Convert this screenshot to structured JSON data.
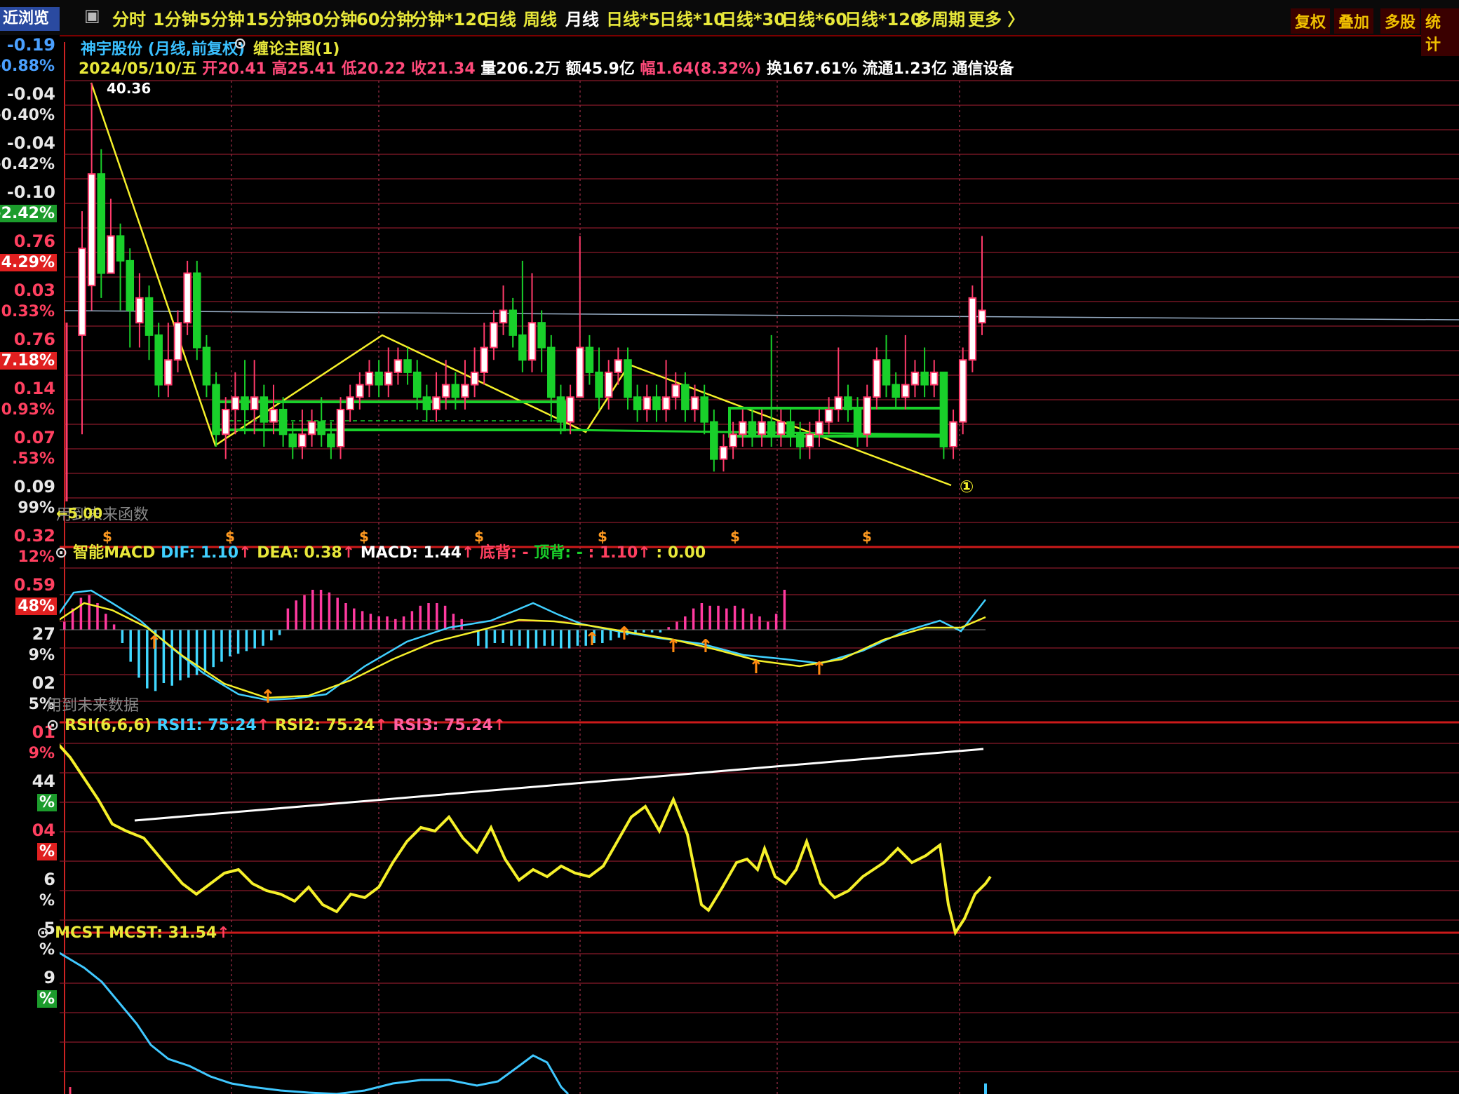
{
  "top_tabs": [
    "分时",
    "1分钟",
    "5分钟",
    "15分钟",
    "30分钟",
    "60分钟",
    "分钟*120",
    "日线",
    "周线",
    "月线",
    "日线*5",
    "日线*10",
    "日线*30",
    "日线*60",
    "日线*120",
    "多周期",
    "更多 〉"
  ],
  "active_tab": "月线",
  "right_buttons": [
    "复权",
    "叠加",
    "多股",
    "统计"
  ],
  "left_panel": {
    "title": "近浏览",
    "items": [
      {
        "v": "-0.19",
        "p": "-0.88%",
        "c": "#4aa0ff",
        "bg": ""
      },
      {
        "v": "-0.04",
        "p": "-0.40%",
        "c": "#e8e8e8",
        "bg": ""
      },
      {
        "v": "-0.04",
        "p": "-0.42%",
        "c": "#e8e8e8",
        "bg": ""
      },
      {
        "v": "-0.10",
        "p": "-2.42%",
        "c": "#e8e8e8",
        "bg": "#1c9c2c"
      },
      {
        "v": "0.76",
        "p": "4.29%",
        "c": "#ff4060",
        "bg": "#e02020"
      },
      {
        "v": "0.03",
        "p": "0.33%",
        "c": "#ff4060",
        "bg": ""
      },
      {
        "v": "0.76",
        "p": "7.18%",
        "c": "#ff4060",
        "bg": "#e02020"
      },
      {
        "v": "0.14",
        "p": "0.93%",
        "c": "#ff4060",
        "bg": ""
      },
      {
        "v": "0.07",
        "p": ".53%",
        "c": "#ff4060",
        "bg": ""
      },
      {
        "v": "0.09",
        "p": "99%",
        "c": "#e8e8e8",
        "bg": ""
      },
      {
        "v": "0.32",
        "p": "12%",
        "c": "#ff4060",
        "bg": ""
      },
      {
        "v": "0.59",
        "p": "48%",
        "c": "#ff4060",
        "bg": "#e02020"
      },
      {
        "v": "27",
        "p": "9%",
        "c": "#e8e8e8",
        "bg": ""
      },
      {
        "v": "02",
        "p": "5%",
        "c": "#e8e8e8",
        "bg": ""
      },
      {
        "v": "01",
        "p": "9%",
        "c": "#ff4060",
        "bg": ""
      },
      {
        "v": "44",
        "p": "%",
        "c": "#e8e8e8",
        "bg": "#1c9c2c"
      },
      {
        "v": "04",
        "p": "%",
        "c": "#ff4060",
        "bg": "#e02020"
      },
      {
        "v": "6",
        "p": "%",
        "c": "#e8e8e8",
        "bg": ""
      },
      {
        "v": "5",
        "p": "%",
        "c": "#e8e8e8",
        "bg": ""
      },
      {
        "v": "9",
        "p": "%",
        "c": "#e8e8e8",
        "bg": "#1c9c2c"
      }
    ]
  },
  "main_chart": {
    "stock_name": "神宇股份",
    "mode": "(月线,前复权)",
    "overlay": "缠论主图(1)",
    "date": "2024/05/10/五",
    "open": "开20.41",
    "high": "高25.41",
    "low": "低20.22",
    "close": "收21.34",
    "volume": "量206.2万",
    "amount": "额45.9亿",
    "change": "幅1.64(8.32%)",
    "turnover": "换167.61%",
    "float": "流通1.23亿",
    "industry": "通信设备",
    "peak_label": "40.36",
    "circle_mark": "①",
    "bottom_left": "用到未来函数",
    "bottom_sub": "←5.00",
    "dollar_mark": "$"
  },
  "macd": {
    "name": "智能MACD",
    "dif": "DIF: 1.10",
    "dea": "DEA: 0.38",
    "macd": "MACD: 1.44",
    "bottom_div": "底背: -",
    "top_div": "顶背: -",
    "extra1": ": 1.10",
    "extra2": ": 0.00",
    "footer": "用到未来数据"
  },
  "rsi": {
    "name": "RSI(6,6,6)",
    "rsi1": "RSI1: 75.24",
    "rsi2": "RSI2: 75.24",
    "rsi3": "RSI3: 75.24"
  },
  "mcst": {
    "name": "MCST",
    "value": "MCST: 31.54"
  },
  "colors": {
    "up": "#ff3a6a",
    "down": "#19d02a",
    "yellow": "#f5f02a",
    "cyan": "#40e0ff",
    "grid": "#8a1a2a",
    "separator": "#cc1a1a"
  },
  "chart_data": {
    "type": "candlestick",
    "peak_value": 40.36,
    "candles": [
      {
        "o": 20,
        "c": 27,
        "h": 30,
        "l": 12
      },
      {
        "o": 24,
        "c": 33,
        "h": 40.36,
        "l": 22
      },
      {
        "o": 33,
        "c": 25,
        "h": 35,
        "l": 23
      },
      {
        "o": 25,
        "c": 28,
        "h": 31,
        "l": 25
      },
      {
        "o": 28,
        "c": 26,
        "h": 29,
        "l": 22
      },
      {
        "o": 26,
        "c": 22,
        "h": 27,
        "l": 19
      },
      {
        "o": 21,
        "c": 23,
        "h": 25,
        "l": 19
      },
      {
        "o": 23,
        "c": 20,
        "h": 24,
        "l": 18
      },
      {
        "o": 20,
        "c": 16,
        "h": 21,
        "l": 15
      },
      {
        "o": 16,
        "c": 18,
        "h": 21,
        "l": 15
      },
      {
        "o": 18,
        "c": 21,
        "h": 22,
        "l": 17
      },
      {
        "o": 21,
        "c": 25,
        "h": 26,
        "l": 20
      },
      {
        "o": 25,
        "c": 19,
        "h": 26,
        "l": 18
      },
      {
        "o": 19,
        "c": 16,
        "h": 20,
        "l": 15
      },
      {
        "o": 16,
        "c": 12,
        "h": 17,
        "l": 11
      },
      {
        "o": 12,
        "c": 14,
        "h": 15,
        "l": 10
      },
      {
        "o": 14,
        "c": 15,
        "h": 17,
        "l": 12
      },
      {
        "o": 15,
        "c": 14,
        "h": 18,
        "l": 12
      },
      {
        "o": 14,
        "c": 15,
        "h": 18,
        "l": 12
      },
      {
        "o": 15,
        "c": 13,
        "h": 16,
        "l": 11
      },
      {
        "o": 13,
        "c": 14,
        "h": 16,
        "l": 12
      },
      {
        "o": 14,
        "c": 12,
        "h": 15,
        "l": 11
      },
      {
        "o": 12,
        "c": 11,
        "h": 13,
        "l": 10
      },
      {
        "o": 11,
        "c": 12,
        "h": 14,
        "l": 10
      },
      {
        "o": 12,
        "c": 13,
        "h": 14,
        "l": 11
      },
      {
        "o": 13,
        "c": 12,
        "h": 15,
        "l": 11
      },
      {
        "o": 12,
        "c": 11,
        "h": 13,
        "l": 10
      },
      {
        "o": 11,
        "c": 14,
        "h": 15,
        "l": 10
      },
      {
        "o": 14,
        "c": 15,
        "h": 16,
        "l": 13
      },
      {
        "o": 15,
        "c": 16,
        "h": 17,
        "l": 14
      },
      {
        "o": 16,
        "c": 17,
        "h": 18,
        "l": 15
      },
      {
        "o": 17,
        "c": 16,
        "h": 18,
        "l": 15
      },
      {
        "o": 16,
        "c": 17,
        "h": 19,
        "l": 15
      },
      {
        "o": 17,
        "c": 18,
        "h": 19,
        "l": 16
      },
      {
        "o": 18,
        "c": 17,
        "h": 19,
        "l": 16
      },
      {
        "o": 17,
        "c": 15,
        "h": 18,
        "l": 14
      },
      {
        "o": 15,
        "c": 14,
        "h": 16,
        "l": 13
      },
      {
        "o": 14,
        "c": 15,
        "h": 17,
        "l": 13
      },
      {
        "o": 15,
        "c": 16,
        "h": 18,
        "l": 14
      },
      {
        "o": 16,
        "c": 15,
        "h": 17,
        "l": 14
      },
      {
        "o": 15,
        "c": 16,
        "h": 18,
        "l": 14
      },
      {
        "o": 16,
        "c": 17,
        "h": 19,
        "l": 15
      },
      {
        "o": 17,
        "c": 19,
        "h": 21,
        "l": 16
      },
      {
        "o": 19,
        "c": 21,
        "h": 22,
        "l": 18
      },
      {
        "o": 21,
        "c": 22,
        "h": 24,
        "l": 20
      },
      {
        "o": 22,
        "c": 20,
        "h": 23,
        "l": 19
      },
      {
        "o": 20,
        "c": 18,
        "h": 26,
        "l": 17
      },
      {
        "o": 18,
        "c": 21,
        "h": 25,
        "l": 17
      },
      {
        "o": 21,
        "c": 19,
        "h": 22,
        "l": 17
      },
      {
        "o": 19,
        "c": 15,
        "h": 20,
        "l": 13
      },
      {
        "o": 15,
        "c": 13,
        "h": 16,
        "l": 12
      },
      {
        "o": 13,
        "c": 15,
        "h": 16,
        "l": 12
      },
      {
        "o": 15,
        "c": 19,
        "h": 28,
        "l": 15
      },
      {
        "o": 19,
        "c": 17,
        "h": 20,
        "l": 16
      },
      {
        "o": 17,
        "c": 15,
        "h": 19,
        "l": 14
      },
      {
        "o": 15,
        "c": 17,
        "h": 18,
        "l": 14
      },
      {
        "o": 17,
        "c": 18,
        "h": 19,
        "l": 16
      },
      {
        "o": 18,
        "c": 15,
        "h": 19,
        "l": 14
      },
      {
        "o": 15,
        "c": 14,
        "h": 16,
        "l": 13
      },
      {
        "o": 14,
        "c": 15,
        "h": 16,
        "l": 13
      },
      {
        "o": 15,
        "c": 14,
        "h": 16,
        "l": 13
      },
      {
        "o": 14,
        "c": 15,
        "h": 18,
        "l": 13
      },
      {
        "o": 15,
        "c": 16,
        "h": 17,
        "l": 14
      },
      {
        "o": 16,
        "c": 14,
        "h": 17,
        "l": 13
      },
      {
        "o": 14,
        "c": 15,
        "h": 16,
        "l": 13
      },
      {
        "o": 15,
        "c": 13,
        "h": 16,
        "l": 12
      },
      {
        "o": 13,
        "c": 10,
        "h": 14,
        "l": 9
      },
      {
        "o": 10,
        "c": 11,
        "h": 12,
        "l": 9
      },
      {
        "o": 11,
        "c": 12,
        "h": 13,
        "l": 10
      },
      {
        "o": 12,
        "c": 13,
        "h": 14,
        "l": 11
      },
      {
        "o": 13,
        "c": 12,
        "h": 14,
        "l": 11
      },
      {
        "o": 12,
        "c": 13,
        "h": 14,
        "l": 11
      },
      {
        "o": 13,
        "c": 12,
        "h": 20,
        "l": 11
      },
      {
        "o": 12,
        "c": 13,
        "h": 14,
        "l": 11
      },
      {
        "o": 13,
        "c": 12,
        "h": 14,
        "l": 11
      },
      {
        "o": 12,
        "c": 11,
        "h": 13,
        "l": 10
      },
      {
        "o": 11,
        "c": 12,
        "h": 13,
        "l": 10
      },
      {
        "o": 12,
        "c": 13,
        "h": 14,
        "l": 11
      },
      {
        "o": 13,
        "c": 14,
        "h": 15,
        "l": 12
      },
      {
        "o": 14,
        "c": 15,
        "h": 19,
        "l": 13
      },
      {
        "o": 15,
        "c": 14,
        "h": 16,
        "l": 13
      },
      {
        "o": 14,
        "c": 12,
        "h": 15,
        "l": 11
      },
      {
        "o": 12,
        "c": 15,
        "h": 16,
        "l": 11
      },
      {
        "o": 15,
        "c": 18,
        "h": 19,
        "l": 14
      },
      {
        "o": 18,
        "c": 16,
        "h": 20,
        "l": 15
      },
      {
        "o": 16,
        "c": 15,
        "h": 17,
        "l": 14
      },
      {
        "o": 15,
        "c": 16,
        "h": 20,
        "l": 14
      },
      {
        "o": 16,
        "c": 17,
        "h": 18,
        "l": 15
      },
      {
        "o": 17,
        "c": 16,
        "h": 19,
        "l": 15
      },
      {
        "o": 16,
        "c": 17,
        "h": 18,
        "l": 15
      },
      {
        "o": 17,
        "c": 11,
        "h": 17,
        "l": 10
      },
      {
        "o": 11,
        "c": 13,
        "h": 14,
        "l": 10
      },
      {
        "o": 13,
        "c": 18,
        "h": 19,
        "l": 12
      },
      {
        "o": 18,
        "c": 23,
        "h": 24,
        "l": 17
      },
      {
        "o": 21,
        "c": 22,
        "h": 28,
        "l": 20
      }
    ]
  }
}
